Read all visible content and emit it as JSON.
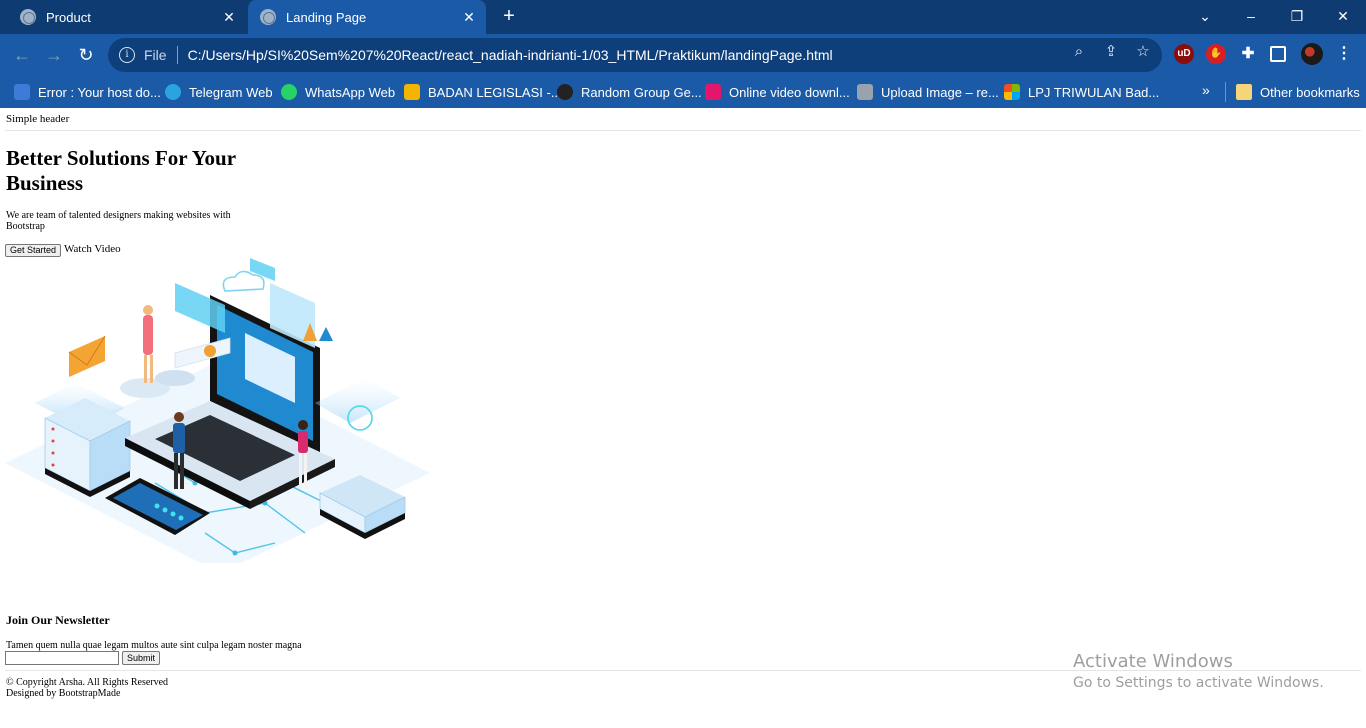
{
  "tabs": [
    {
      "title": "Product",
      "active": false
    },
    {
      "title": "Landing Page",
      "active": true
    }
  ],
  "toolbar": {
    "scheme": "File",
    "url": "C:/Users/Hp/SI%20Sem%207%20React/react_nadiah-indrianti-1/03_HTML/Praktikum/landingPage.html"
  },
  "bookmarks": [
    {
      "label": "Error : Your host do...",
      "icon": "vmw-icon",
      "color": "#3d7bd6"
    },
    {
      "label": "Telegram Web",
      "icon": "telegram-icon",
      "color": "#2aa3e0"
    },
    {
      "label": "WhatsApp Web",
      "icon": "whatsapp-icon",
      "color": "#25d366"
    },
    {
      "label": "BADAN LEGISLASI -...",
      "icon": "google-drive-icon",
      "color": "#f4b400"
    },
    {
      "label": "Random Group Ge...",
      "icon": "random-group-icon",
      "color": "#222222"
    },
    {
      "label": "Online video downl...",
      "icon": "video-download-icon",
      "color": "#e3166b"
    },
    {
      "label": "Upload Image – re...",
      "icon": "upload-image-icon",
      "color": "#9aa3ad"
    },
    {
      "label": "LPJ TRIWULAN Bad...",
      "icon": "microsoft-icon",
      "color": "#f25022"
    }
  ],
  "other_bookmarks": "Other bookmarks",
  "page": {
    "header": "Simple header",
    "hero_title": "Better Solutions For Your Business",
    "hero_subtitle": "We are team of talented designers making websites with Bootstrap",
    "get_started": "Get Started",
    "watch_video": "Watch Video",
    "newsletter_title": "Join Our Newsletter",
    "newsletter_text": "Tamen quem nulla quae legam multos aute sint culpa legam noster magna",
    "newsletter_placeholder": "",
    "submit": "Submit",
    "copyright": "© Copyright Arsha. All Rights Reserved",
    "designed_by": "Designed by BootstrapMade"
  },
  "watermark": {
    "line1": "Activate Windows",
    "line2": "Go to Settings to activate Windows."
  }
}
